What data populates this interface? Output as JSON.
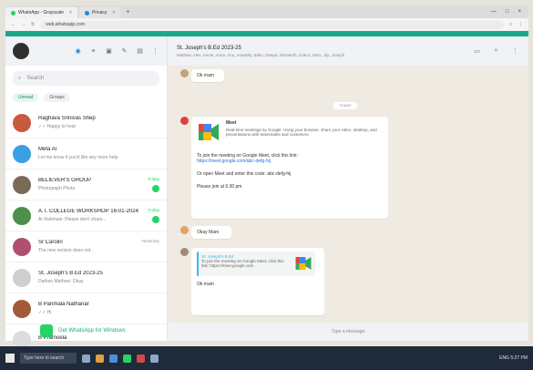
{
  "browser": {
    "tabs": [
      {
        "title": "WhatsApp - Grayscale",
        "active": true
      },
      {
        "title": "Privacy",
        "active": false
      }
    ],
    "url": "web.whatsapp.com"
  },
  "sidebar": {
    "search_placeholder": "Search",
    "filters": [
      "Unread",
      "Groups"
    ],
    "chats": [
      {
        "name": "Raghava Srinivas Shep",
        "preview": "✓✓ Happy to hear",
        "time": "",
        "color": "#c85a3c"
      },
      {
        "name": "Meta AI",
        "preview": "Let me know if you'd like any more help",
        "time": "",
        "color": "#3aa0e6"
      },
      {
        "name": "BELIEVER'S GROUP",
        "preview": "Photograph Photo",
        "time": "Friday",
        "color": "#7a6a5a",
        "unread": true
      },
      {
        "name": "A.T. COLLEGE WORKSHOP 16-01-2024",
        "preview": "Ar Rahmani: Please don't share...",
        "time": "Friday",
        "color": "#4d8f4d",
        "unread": true
      },
      {
        "name": "Sr Carolin",
        "preview": "The new version does not..",
        "time": "Yesterday",
        "color": "#b0506e"
      },
      {
        "name": "St. Joseph's B.Ed 2023-25",
        "preview": "Dathan Mathew: Okay",
        "time": "",
        "color": "#cfcfcf"
      },
      {
        "name": "B Parimala Nathanar",
        "preview": "✓✓ Hi",
        "time": "",
        "color": "#a05a3a"
      },
      {
        "name": "B Pramoela",
        "preview": "",
        "time": "",
        "color": "#dcdcdc"
      }
    ],
    "get_windows": "Get WhatsApp for Windows"
  },
  "conversation": {
    "title": "St. Joseph's B.Ed 2023-25",
    "subtitle": "Mathew, Alex, Annie, Anna, Anu, Aswathy, Bibin, Deepa, Elizabeth, Gokul, Jerin, Jijo, Joseph",
    "date_pill": "TODAY",
    "messages": {
      "m1": {
        "sender": "",
        "text": "Ok mam"
      },
      "m2": {
        "sender": "",
        "card_title": "Meet",
        "card_text": "Real-time meetings by Google. Using your browser, share your video, desktop, and presentations with teammates and customers.",
        "line1": "To join the meeting on Google Meet, click this link:",
        "link": "https://meet.google.com/abc-defg-hij",
        "line2": "Or open Meet and enter this code: abc-defg-hij",
        "line3": "Please join at 6:30 pm"
      },
      "m3": {
        "sender": "",
        "text": "Okay Mam"
      },
      "m4": {
        "quote_sender": "St. Joseph's B.Ed",
        "quote_text": "To join the meeting on Google Meet, click this link: https://meet.google.com",
        "text": "Ok mam"
      }
    },
    "composer_placeholder": "Type a message"
  },
  "taskbar": {
    "search": "Type here to search",
    "tray": "ENG  5:27 PM"
  },
  "colors": {
    "accent": "#19a88a",
    "green": "#25d366"
  }
}
